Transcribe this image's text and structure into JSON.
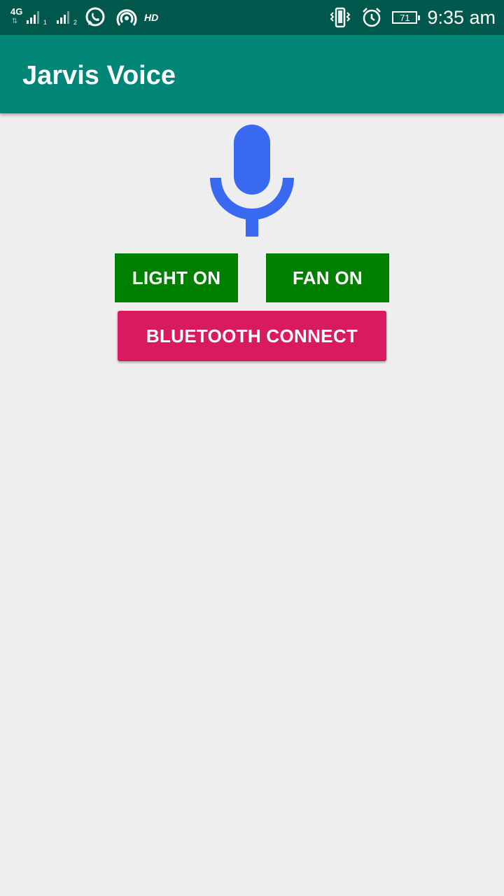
{
  "status_bar": {
    "network_type": "4G",
    "network_arrows": "⇅",
    "sim1_label": "1",
    "sim2_label": "2",
    "hd_label": "HD",
    "battery_level": "71",
    "time": "9:35 am",
    "icons": [
      "signal-icon",
      "whatsapp-icon",
      "hotspot-icon",
      "vibrate-icon",
      "alarm-icon",
      "battery-icon"
    ]
  },
  "app_bar": {
    "title": "Jarvis Voice",
    "color": "#008577"
  },
  "main": {
    "mic_icon": "microphone-icon",
    "mic_color": "#3869f0",
    "light_button_label": "LIGHT ON",
    "fan_button_label": "FAN ON",
    "bluetooth_button_label": "BLUETOOTH CONNECT",
    "toggle_button_color": "#008000",
    "bluetooth_button_color": "#d81b60"
  }
}
